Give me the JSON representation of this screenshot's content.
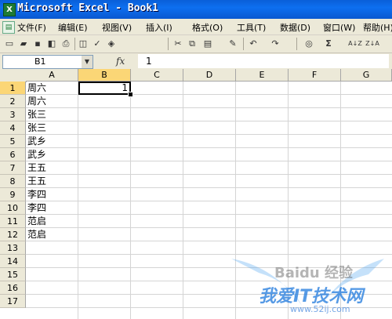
{
  "window": {
    "title": "Microsoft Excel - Book1",
    "app_icon": "excel-icon"
  },
  "menubar": {
    "items": [
      "文件(F)",
      "编辑(E)",
      "视图(V)",
      "插入(I)",
      "格式(O)",
      "工具(T)",
      "数据(D)",
      "窗口(W)",
      "帮助(H)"
    ]
  },
  "toolbar": {
    "icons": [
      "new-icon",
      "open-icon",
      "save-icon",
      "permission-icon",
      "print-icon",
      "print-preview-icon",
      "spelling-icon",
      "research-icon",
      "cut-icon",
      "copy-icon",
      "paste-icon",
      "format-painter-icon",
      "undo-icon",
      "redo-icon",
      "hyperlink-icon",
      "autosum-icon",
      "sort-ascending-icon",
      "sort-descending-icon"
    ],
    "labels": {
      "autosum": "Σ",
      "sort_asc": "A↓Z",
      "sort_desc": "Z↓A"
    }
  },
  "formulabar": {
    "name_box": "B1",
    "fx_label": "fx",
    "formula": "1"
  },
  "sheet": {
    "columns": [
      "A",
      "B",
      "C",
      "D",
      "E",
      "F",
      "G"
    ],
    "selected_column": "B",
    "selected_row": "1",
    "rows": [
      "1",
      "2",
      "3",
      "4",
      "5",
      "6",
      "7",
      "8",
      "9",
      "10",
      "11",
      "12",
      "13",
      "14",
      "15",
      "16",
      "17"
    ],
    "column_a": [
      "周六",
      "周六",
      "张三",
      "张三",
      "武乡",
      "武乡",
      "王五",
      "王五",
      "李四",
      "李四",
      "范启",
      "范启"
    ],
    "b1": "1"
  },
  "watermark": {
    "line1": "Baidu 经验",
    "line2": "我爱IT技术网",
    "line3": "www.52ij.com"
  }
}
